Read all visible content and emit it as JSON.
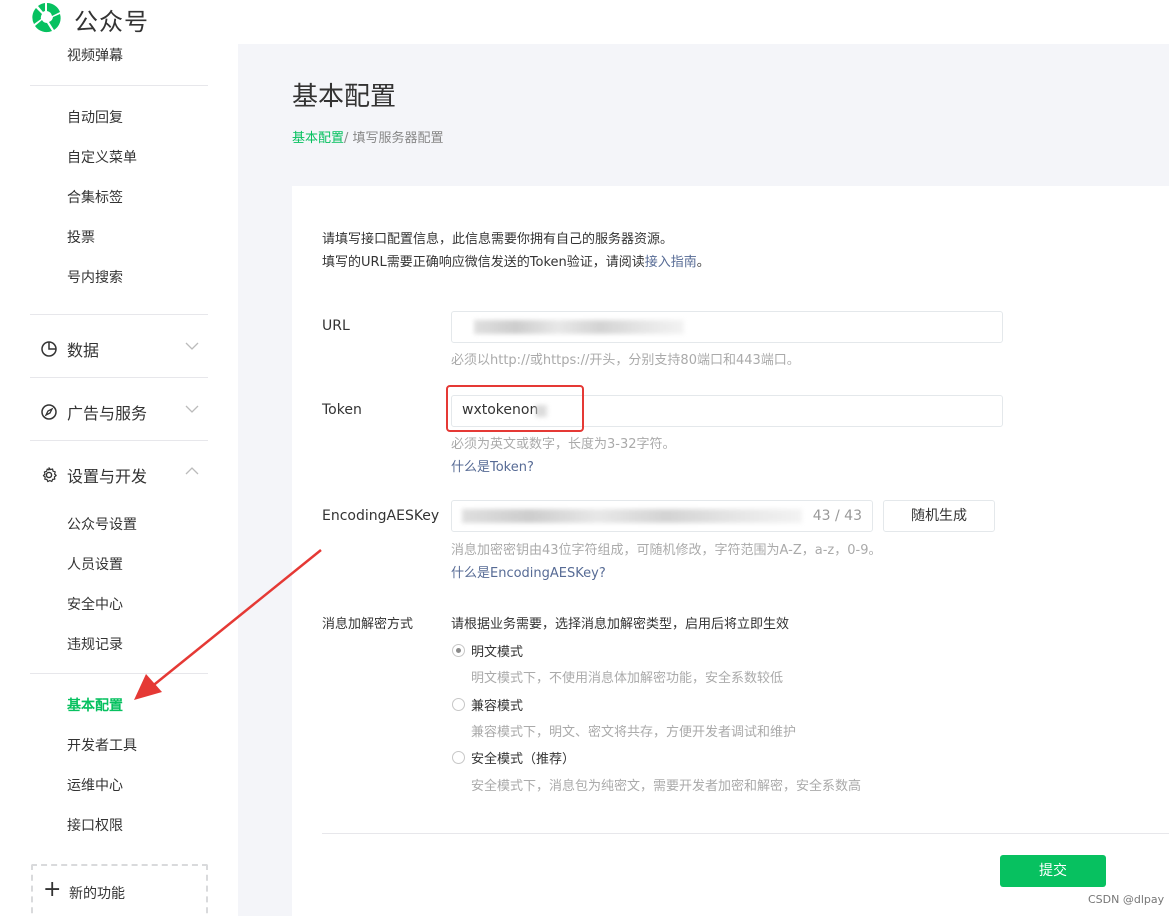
{
  "app": {
    "title": "公众号"
  },
  "sidebar": {
    "top_items": [
      "视频弹幕",
      "自动回复",
      "自定义菜单",
      "合集标签",
      "投票",
      "号内搜索"
    ],
    "groups": {
      "data": "数据",
      "ads": "广告与服务",
      "settings": "设置与开发"
    },
    "settings_items": [
      "公众号设置",
      "人员设置",
      "安全中心",
      "违规记录"
    ],
    "dev_items": [
      "基本配置",
      "开发者工具",
      "运维中心",
      "接口权限"
    ],
    "new_features": "新的功能"
  },
  "page": {
    "title": "基本配置",
    "breadcrumb": {
      "link": "基本配置",
      "separator": "/",
      "current": "填写服务器配置"
    }
  },
  "form": {
    "intro_line1": "请填写接口配置信息，此信息需要你拥有自己的服务器资源。",
    "intro_line2_prefix": "填写的URL需要正确响应微信发送的Token验证，请阅读",
    "intro_line2_link": "接入指南",
    "intro_line2_suffix": "。",
    "url": {
      "label": "URL",
      "hint": "必须以http://或https://开头，分别支持80端口和443端口。"
    },
    "token": {
      "label": "Token",
      "value": "wxtokenon",
      "hint": "必须为英文或数字，长度为3-32字符。",
      "help": "什么是Token?"
    },
    "aes": {
      "label": "EncodingAESKey",
      "count": "43 / 43",
      "button": "随机生成",
      "hint": "消息加密密钥由43位字符组成，可随机修改，字符范围为A-Z，a-z，0-9。",
      "help": "什么是EncodingAESKey?"
    },
    "encrypt": {
      "label": "消息加解密方式",
      "hint": "请根据业务需要，选择消息加解密类型，启用后将立即生效",
      "options": [
        {
          "label": "明文模式",
          "desc": "明文模式下，不使用消息体加解密功能，安全系数较低",
          "checked": true
        },
        {
          "label": "兼容模式",
          "desc": "兼容模式下，明文、密文将共存，方便开发者调试和维护",
          "checked": false
        },
        {
          "label": "安全模式（推荐）",
          "desc": "安全模式下，消息包为纯密文，需要开发者加密和解密，安全系数高",
          "checked": false
        }
      ]
    },
    "submit": "提交"
  },
  "watermark": "CSDN @dlpay",
  "colors": {
    "accent": "#07c160",
    "link": "#576b95",
    "annotation": "#e53935"
  }
}
